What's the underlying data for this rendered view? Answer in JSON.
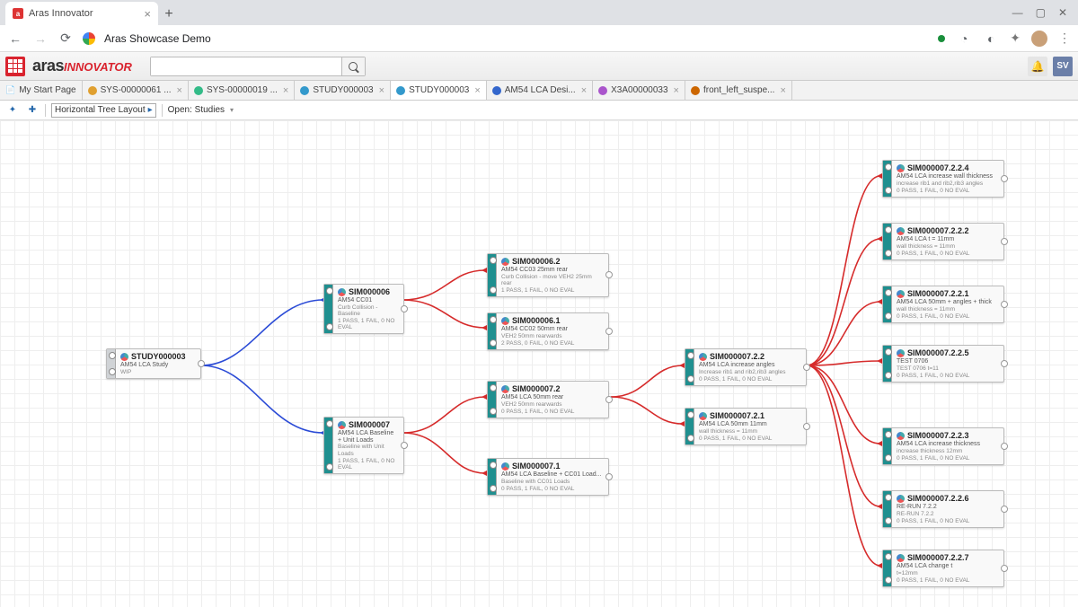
{
  "browser": {
    "tab_title": "Aras Innovator",
    "address": "Aras Showcase Demo",
    "user_initials": "SV"
  },
  "app": {
    "logo_main": "aras",
    "logo_sub": "INNOVATOR",
    "search_placeholder": ""
  },
  "app_tabs": [
    {
      "label": "My Start Page",
      "icon": "#888",
      "active": false,
      "closable": false
    },
    {
      "label": "SYS-00000061 ...",
      "icon": "#e0a030",
      "active": false,
      "closable": true
    },
    {
      "label": "SYS-00000019 ...",
      "icon": "#3b8",
      "active": false,
      "closable": true
    },
    {
      "label": "STUDY000003",
      "icon": "#39c",
      "active": false,
      "closable": true
    },
    {
      "label": "STUDY000003",
      "icon": "#39c",
      "active": true,
      "closable": true
    },
    {
      "label": "AM54 LCA Desi...",
      "icon": "#36c",
      "active": false,
      "closable": true
    },
    {
      "label": "X3A00000033",
      "icon": "#a5c",
      "active": false,
      "closable": true
    },
    {
      "label": "front_left_suspe...",
      "icon": "#c60",
      "active": false,
      "closable": true
    }
  ],
  "toolbar": {
    "layout_label": "Horizontal Tree Layout",
    "open_label": "Open: Studies"
  },
  "nodes": {
    "study": {
      "id": "STUDY000003",
      "sub": "AM54 LCA Study",
      "det": "WIP",
      "status": ""
    },
    "sim6": {
      "id": "SIM000006",
      "sub": "AM54 CC01",
      "det": "Curb Collision - Baseline",
      "status": "1 PASS, 1 FAIL, 0 NO EVAL"
    },
    "sim62": {
      "id": "SIM000006.2",
      "sub": "AM54 CC03 25mm rear",
      "det": "Curb Collision - move VEH2 25mm rear",
      "status": "1 PASS, 1 FAIL, 0 NO EVAL"
    },
    "sim61": {
      "id": "SIM000006.1",
      "sub": "AM54 CC02 50mm rear",
      "det": "VEH2 50mm rearwards",
      "status": "2 PASS, 0 FAIL, 0 NO EVAL"
    },
    "sim7": {
      "id": "SIM000007",
      "sub": "AM54 LCA Baseline + Unit Loads",
      "det": "Baseline with Unit Loads",
      "status": "1 PASS, 1 FAIL, 0 NO EVAL"
    },
    "sim72": {
      "id": "SIM000007.2",
      "sub": "AM54 LCA 50mm rear",
      "det": "VEH2 50mm rearwards",
      "status": "0 PASS, 1 FAIL, 0 NO EVAL"
    },
    "sim71": {
      "id": "SIM000007.1",
      "sub": "AM54 LCA Baseline + CC01 Load...",
      "det": "Baseline with CC01 Loads",
      "status": "0 PASS, 1 FAIL, 0 NO EVAL"
    },
    "sim722": {
      "id": "SIM000007.2.2",
      "sub": "AM54 LCA increase angles",
      "det": "Increase rib1 and rib2,rib3 angles",
      "status": "0 PASS, 1 FAIL, 0 NO EVAL"
    },
    "sim721": {
      "id": "SIM000007.2.1",
      "sub": "AM54 LCA 50mm 11mm",
      "det": "wall thickness = 11mm",
      "status": "0 PASS, 1 FAIL, 0 NO EVAL"
    },
    "sim7224": {
      "id": "SIM000007.2.2.4",
      "sub": "AM54 LCA increase wall thickness",
      "det": "increase rib1 and rib2,rib3 angles",
      "status": "0 PASS, 1 FAIL, 0 NO EVAL"
    },
    "sim7222": {
      "id": "SIM000007.2.2.2",
      "sub": "AM54 LCA t = 11mm",
      "det": "wall thickness = 11mm",
      "status": "0 PASS, 1 FAIL, 0 NO EVAL"
    },
    "sim7221": {
      "id": "SIM000007.2.2.1",
      "sub": "AM54 LCA 50mm + angles + thick",
      "det": "wall thickness = 11mm",
      "status": "0 PASS, 1 FAIL, 0 NO EVAL"
    },
    "sim7225": {
      "id": "SIM000007.2.2.5",
      "sub": "TEST 0706",
      "det": "TEST 0706 t=11",
      "status": "0 PASS, 1 FAIL, 0 NO EVAL"
    },
    "sim7223": {
      "id": "SIM000007.2.2.3",
      "sub": "AM54 LCA increase thickness",
      "det": "increase thickness 12mm",
      "status": "0 PASS, 1 FAIL, 0 NO EVAL"
    },
    "sim7226": {
      "id": "SIM000007.2.2.6",
      "sub": "RE-RUN 7.2.2",
      "det": "RE-RUN 7.2.2",
      "status": "0 PASS, 1 FAIL, 0 NO EVAL"
    },
    "sim7227": {
      "id": "SIM000007.2.2.7",
      "sub": "AM54 LCA change t",
      "det": "t=12mm",
      "status": "0 PASS, 1 FAIL, 0 NO EVAL"
    }
  }
}
